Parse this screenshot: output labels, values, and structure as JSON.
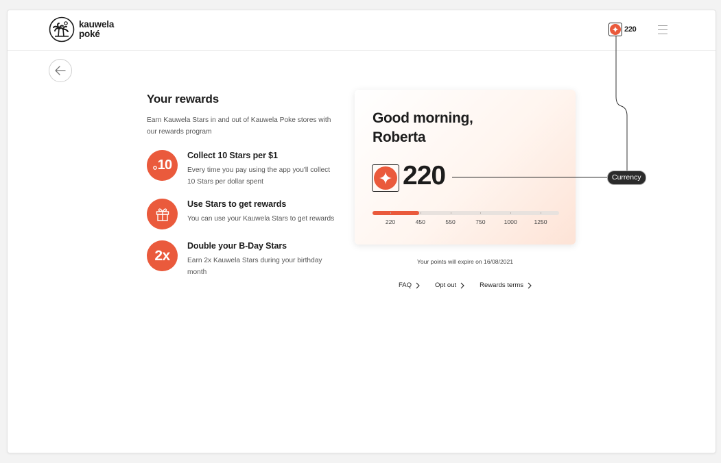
{
  "brand": {
    "name_line1": "kauwela",
    "name_line2": "poké"
  },
  "header": {
    "points": "220",
    "menu_icon": "hamburger-menu-icon"
  },
  "back": {
    "icon": "arrow-left-icon"
  },
  "rewards": {
    "title": "Your rewards",
    "intro": "Earn Kauwela Stars in and out of Kauwela Poke stores with our rewards program",
    "benefits": [
      {
        "badge": "10",
        "title": "Collect 10 Stars per $1",
        "desc": "Every time you pay using the app you'll collect 10 Stars per dollar spent"
      },
      {
        "badge_icon": "gift-icon",
        "title": "Use Stars to get rewards",
        "desc": "You can use your Kauwela Stars to get rewards"
      },
      {
        "badge": "2x",
        "title": "Double your B-Day Stars",
        "desc": "Earn 2x Kauwela Stars during your birthday month"
      }
    ]
  },
  "card": {
    "greeting_line1": "Good morning,",
    "greeting_line2": "Roberta",
    "points": "220",
    "progress": {
      "current": 220,
      "min": 220,
      "max": 1250,
      "fill_value": 470
    },
    "ticks": [
      "220",
      "450",
      "550",
      "750",
      "1000",
      "1250"
    ]
  },
  "expire_text": "Your points will expire on 16/08/2021",
  "links": {
    "faq": "FAQ",
    "opt_out": "Opt out",
    "terms": "Rewards terms"
  },
  "annotation": {
    "label": "Currency"
  },
  "colors": {
    "accent": "#ea5a3c",
    "text": "#1c1c1c",
    "muted": "#555555"
  }
}
